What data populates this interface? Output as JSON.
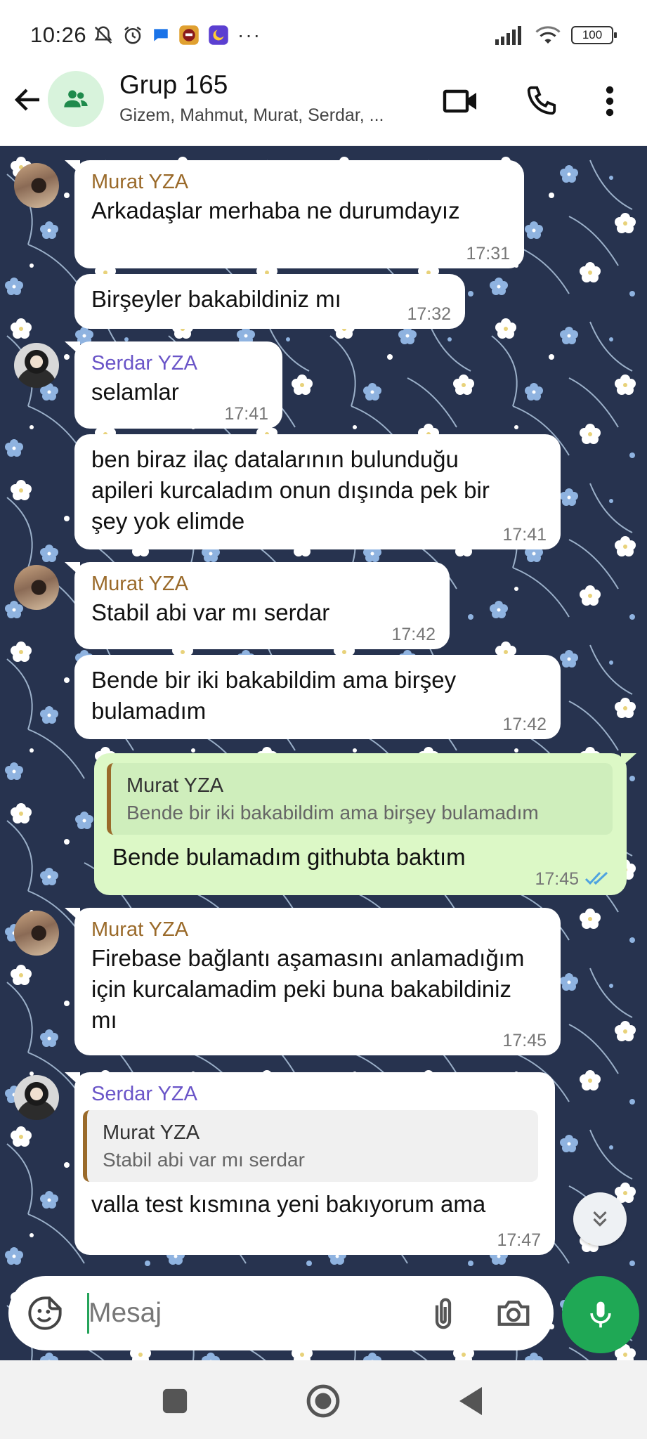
{
  "status_bar": {
    "time": "10:26",
    "battery": "100"
  },
  "header": {
    "title": "Grup 165",
    "subtitle": "Gizem, Mahmut, Murat, Serdar, ..."
  },
  "messages": [
    {
      "sender": "Murat YZA",
      "text": "Arkadaşlar merhaba ne durumdayız",
      "time": "17:31"
    },
    {
      "text": "Birşeyler bakabildiniz mı",
      "time": "17:32"
    },
    {
      "sender": "Serdar YZA",
      "text": "selamlar",
      "time": "17:41"
    },
    {
      "text": "ben biraz ilaç datalarının bulunduğu apileri kurcaladım onun dışında pek bir şey yok elimde",
      "time": "17:41"
    },
    {
      "sender": "Murat YZA",
      "text": "Stabil abi var mı serdar",
      "time": "17:42"
    },
    {
      "text": "Bende bir iki bakabildim ama birşey bulamadım",
      "time": "17:42"
    },
    {
      "quote_name": "Murat YZA",
      "quote_text": "Bende bir iki bakabildim ama birşey bulamadım",
      "text": "Bende bulamadım githubta baktım",
      "time": "17:45"
    },
    {
      "sender": "Murat YZA",
      "text": "Firebase bağlantı aşamasını anlamadığım için kurcalamadim peki buna bakabildiniz mı",
      "time": "17:45"
    },
    {
      "sender": "Serdar YZA",
      "quote_name": "Murat YZA",
      "quote_text": "Stabil abi var mı serdar",
      "text": "valla test kısmına yeni bakıyorum ama",
      "time": "17:47"
    }
  ],
  "composer": {
    "placeholder": "Mesaj"
  },
  "colors": {
    "accent_green": "#1fa855",
    "outgoing_bubble": "#dcf8c6",
    "wallpaper": "#27334f",
    "murat_name": "#9a6a2a",
    "serdar_name": "#6a55c8",
    "read_ticks": "#4fa3e0"
  },
  "icons": [
    "back-arrow-icon",
    "group-icon",
    "video-call-icon",
    "phone-icon",
    "more-vert-icon",
    "double-chevron-down-icon",
    "sticker-icon",
    "attach-icon",
    "camera-icon",
    "mic-icon",
    "read-receipt-icon",
    "nav-square-icon",
    "nav-home-icon",
    "nav-back-icon"
  ]
}
